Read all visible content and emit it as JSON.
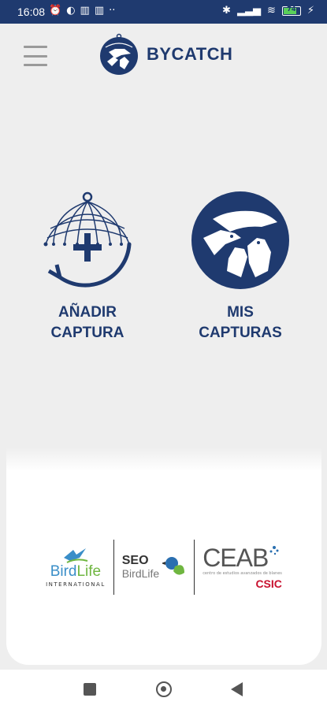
{
  "status_bar": {
    "time": "16:08",
    "battery_text": "74",
    "left_icons": [
      "alarm-icon",
      "app-icon",
      "trash-icon",
      "trash-icon",
      "more-icon"
    ],
    "right_icons": [
      "bluetooth-icon",
      "signal-icon",
      "wifi-icon",
      "battery-icon",
      "charging-icon"
    ]
  },
  "header": {
    "app_name": "BYCATCH",
    "menu_icon": "hamburger-menu-icon"
  },
  "actions": {
    "add": {
      "line1": "AÑADIR",
      "line2": "CAPTURA",
      "icon": "add-capture-net-icon"
    },
    "list": {
      "line1": "MIS",
      "line2": "CAPTURAS",
      "icon": "seabirds-icon"
    }
  },
  "partners": {
    "birdlife": {
      "name_part1": "Bird",
      "name_part2": "Life",
      "sub": "INTERNATIONAL"
    },
    "seo": {
      "line1": "SEO",
      "line2": "BirdLife"
    },
    "ceab": {
      "name": "CEAB",
      "sub": "centro de estudios avanzados de blanes",
      "org": "CSIC"
    }
  },
  "colors": {
    "brand": "#1f3a6f",
    "status_bar": "#1f3a6f",
    "background": "#eeeeee"
  }
}
